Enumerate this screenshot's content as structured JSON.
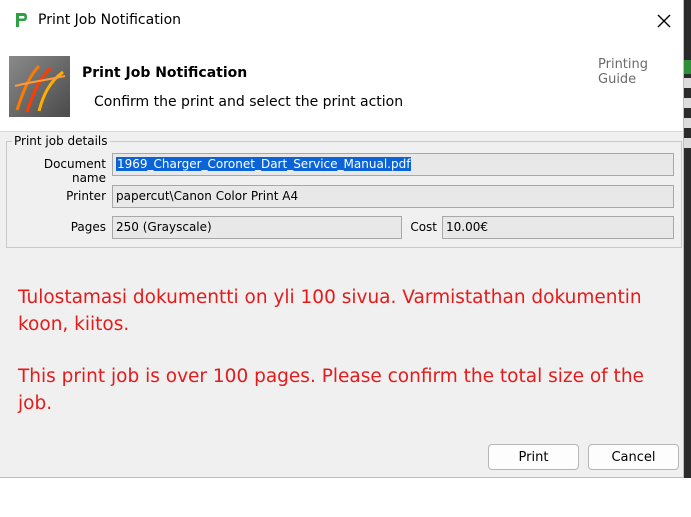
{
  "window": {
    "title": "Print Job Notification"
  },
  "header": {
    "title": "Print Job Notification",
    "subtitle": "Confirm the print and select the print action",
    "guide_link": "Printing Guide"
  },
  "details": {
    "group_label": "Print job details",
    "document_label": "Document name",
    "document_value": "1969_Charger_Coronet_Dart_Service_Manual.pdf",
    "printer_label": "Printer",
    "printer_value": "papercut\\Canon Color Print A4",
    "pages_label": "Pages",
    "pages_value": "250   (Grayscale)",
    "cost_label": "Cost",
    "cost_value": "10.00€"
  },
  "messages": {
    "finnish_line1": "Tulostamasi dokumentti on yli 100 sivua. Varmistathan dokumentin",
    "finnish_line2": "koon, kiitos.",
    "english_line1": "This print job is over 100 pages. Please confirm the total size of the",
    "english_line2": "job."
  },
  "buttons": {
    "print": "Print",
    "cancel": "Cancel"
  },
  "colors": {
    "message": "#e51a1a",
    "selection": "#0a64d8",
    "app_icon": "#2ea043"
  }
}
